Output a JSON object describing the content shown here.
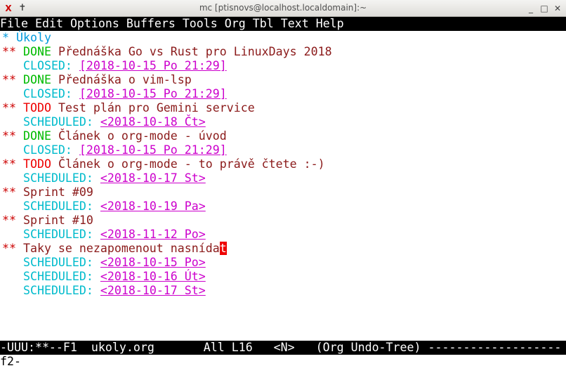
{
  "window": {
    "title": "mc [ptisnovs@localhost.localdomain]:~",
    "icon": "x-terminal-icon",
    "buttons": {
      "pin": "✝",
      "minimize": "_",
      "maximize": "□",
      "close": "✕"
    }
  },
  "menubar": {
    "items": [
      "File",
      "Edit",
      "Options",
      "Buffers",
      "Tools",
      "Org",
      "Tbl",
      "Text",
      "Help"
    ]
  },
  "buffer": {
    "top_heading": {
      "star": "*",
      "title": "Úkoly"
    },
    "entries": [
      {
        "stars": "**",
        "state": "DONE",
        "title": "Přednáška Go vs Rust pro LinuxDays 2018",
        "kw": "CLOSED:",
        "ts": "[2018-10-15 Po 21:29]"
      },
      {
        "stars": "**",
        "state": "DONE",
        "title": "Přednáška o vim-lsp",
        "kw": "CLOSED:",
        "ts": "[2018-10-15 Po 21:29]"
      },
      {
        "stars": "**",
        "state": "TODO",
        "title": "Test plán pro Gemini service",
        "kw": "SCHEDULED:",
        "ts": "<2018-10-18 Čt>"
      },
      {
        "stars": "**",
        "state": "DONE",
        "title": "Článek o org-mode - úvod",
        "kw": "CLOSED:",
        "ts": "[2018-10-15 Po 21:29]"
      },
      {
        "stars": "**",
        "state": "TODO",
        "title": "Článek o org-mode - to právě čtete :-)",
        "kw": "SCHEDULED:",
        "ts": "<2018-10-17 St>"
      },
      {
        "stars": "**",
        "state": "",
        "title": "Sprint #09",
        "kw": "SCHEDULED:",
        "ts": "<2018-10-19 Pa>"
      },
      {
        "stars": "**",
        "state": "",
        "title": "Sprint #10",
        "kw": "SCHEDULED:",
        "ts": "<2018-11-12 Po>"
      }
    ],
    "last_entry": {
      "stars": "**",
      "title_before_cursor": "Taky se nezapomenout nasnída",
      "cursor_char": "t",
      "schedules": [
        {
          "kw": "SCHEDULED:",
          "ts": "<2018-10-15 Po>"
        },
        {
          "kw": "SCHEDULED:",
          "ts": "<2018-10-16 Út>"
        },
        {
          "kw": "SCHEDULED:",
          "ts": "<2018-10-17 St>"
        }
      ]
    }
  },
  "modeline": {
    "status": "-UUU:**--F1",
    "buffer_name": "ukoly.org",
    "position": "All L16",
    "evil_state": "<N>",
    "modes": "(Org Undo-Tree)",
    "filler": "-------------------"
  },
  "minibuffer": {
    "text": "f2-"
  },
  "colors": {
    "done": "#00bb00",
    "todo": "#ee0000",
    "heading": "#8b1a1a",
    "keyword": "#00bbcc",
    "timestamp": "#cc00cc",
    "top_heading": "#0099dd"
  }
}
